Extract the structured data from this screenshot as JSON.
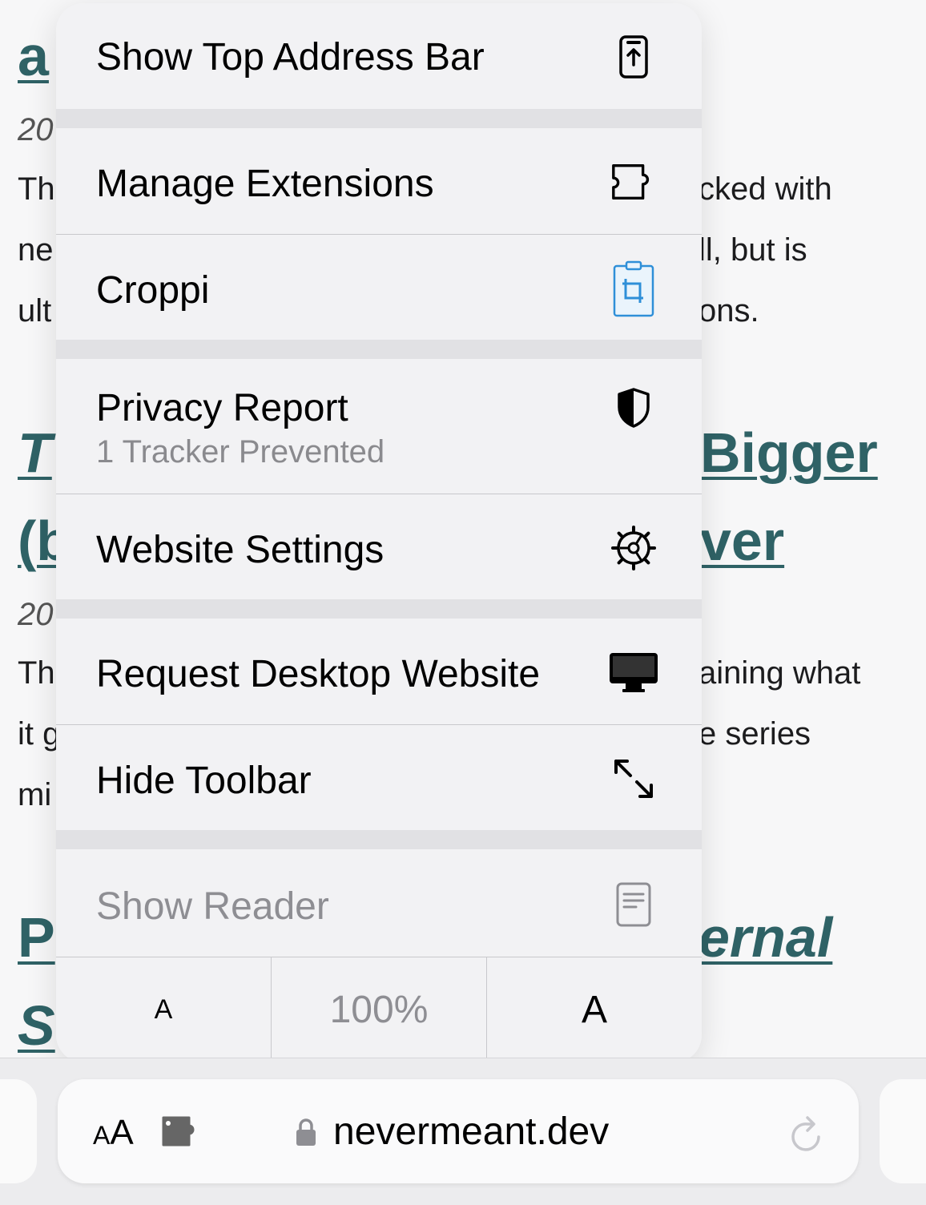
{
  "background": {
    "texts": [
      "a",
      "20",
      "Th",
      "cked with",
      "ne",
      "ll, but is",
      "ult",
      "ons.",
      "T",
      "Bigger",
      "(b",
      "ver",
      "20",
      "Th",
      "aining what",
      "it g",
      "e series",
      "mi",
      "P",
      "ernal",
      "S"
    ]
  },
  "menu": {
    "show_top_address_bar": "Show Top Address Bar",
    "manage_extensions": "Manage Extensions",
    "croppi": "Croppi",
    "privacy_report": "Privacy Report",
    "privacy_report_sub": "1 Tracker Prevented",
    "website_settings": "Website Settings",
    "request_desktop": "Request Desktop Website",
    "hide_toolbar": "Hide Toolbar",
    "show_reader": "Show Reader",
    "zoom": {
      "smaller": "A",
      "level": "100%",
      "larger": "A"
    }
  },
  "toolbar": {
    "aa_small": "A",
    "aa_large": "A",
    "url": "nevermeant.dev"
  },
  "colors": {
    "link": "#2f6266",
    "croppi": "#2f8fd8"
  }
}
